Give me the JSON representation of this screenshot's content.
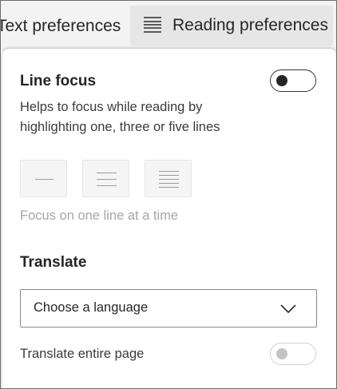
{
  "tabs": [
    {
      "label": "Text preferences",
      "active": false
    },
    {
      "label": "Reading preferences",
      "active": true,
      "icon": "lines-icon"
    }
  ],
  "line_focus": {
    "title": "Line focus",
    "description": "Helps to focus while reading by highlighting one, three or five lines",
    "toggle_on": false,
    "options": [
      {
        "name": "one-line",
        "icon": "one-line-icon"
      },
      {
        "name": "three-lines",
        "icon": "three-lines-icon"
      },
      {
        "name": "five-lines",
        "icon": "five-lines-icon"
      }
    ],
    "hint": "Focus on one line at a time"
  },
  "translate": {
    "title": "Translate",
    "select_value": "Choose a language",
    "select_icon": "chevron-down-icon",
    "entire_page_label": "Translate entire page",
    "entire_page_on": false
  },
  "colors": {
    "tab_active_bg": "#e6e6e6",
    "disabled_text": "#a6a6a6",
    "text": "#242424"
  }
}
